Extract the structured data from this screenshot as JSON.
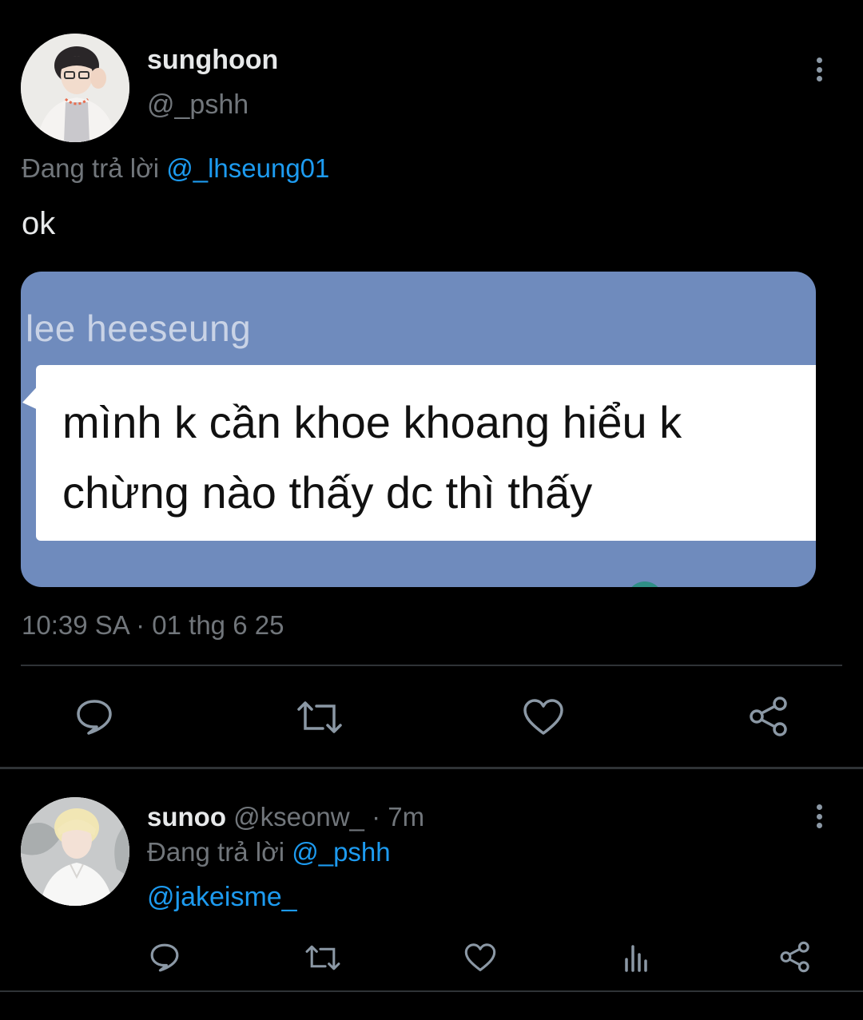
{
  "main_tweet": {
    "display_name": "sunghoon",
    "handle": "@_pshh",
    "reply_prefix": "Đang trả lời",
    "reply_to": "@_lhseung01",
    "text": "ok",
    "media": {
      "sender_name": "lee heeseung",
      "message_line_1": "mình k cần khoe khoang hiểu k",
      "message_line_2": "chừng nào thấy dc thì thấy"
    },
    "timestamp": "10:39 SA · 01 thg 6 25",
    "actions": [
      "reply-icon",
      "retweet-icon",
      "like-icon",
      "share-icon"
    ],
    "more_icon": "more-vertical-icon"
  },
  "reply_tweet": {
    "display_name": "sunoo",
    "handle": "@kseonw_",
    "separator": "·",
    "age": "7m",
    "reply_prefix": "Đang trả lời",
    "reply_to": "@_pshh",
    "text": "@jakeisme_",
    "actions": [
      "reply-icon",
      "retweet-icon",
      "like-icon",
      "views-icon",
      "share-icon"
    ],
    "more_icon": "more-vertical-icon"
  },
  "colors": {
    "background": "#000000",
    "text_primary": "#e7e9ea",
    "text_secondary": "#71767b",
    "accent": "#1d9bf0",
    "divider": "#2f3336",
    "media_bg": "#6f8bbd"
  }
}
